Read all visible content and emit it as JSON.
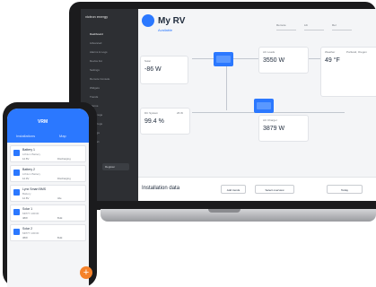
{
  "laptop": {
    "logo": "victron energy",
    "sidebar": [
      "Dashboard",
      "Advanced",
      "Alarms & Logs",
      "Device list",
      "Settings",
      "Remote Console",
      "Widgets",
      "Trends",
      "Alarms",
      "Alarm logs",
      "Event logs",
      "Settings",
      "Support"
    ],
    "active_index": 0,
    "footer": "Register",
    "title": "My RV",
    "status": "Available",
    "selects": [
      "Remote",
      "Lib",
      "Rel"
    ],
    "cards": {
      "solar": {
        "title": "Solar",
        "value": "-86 W"
      },
      "ac_loads": {
        "title": "AC Loads",
        "value": "3550 W"
      },
      "weather": {
        "title": "Weather",
        "value": "49 °F",
        "location": "Portland, Oregon"
      },
      "dc_system": {
        "title": "DC System",
        "value": "99.4 %",
        "extra": "26 W"
      },
      "ac_charger": {
        "title": "AC Charger",
        "value": "3879 W"
      }
    },
    "bottom": {
      "label": "Installation data",
      "btn1": "Add trends",
      "btn2": "Select overview",
      "btn3": "Today"
    }
  },
  "phone": {
    "title": "VRM",
    "tabs": [
      "Installations",
      "Map"
    ],
    "rows": [
      {
        "name": "Battery 1",
        "sub": "Lithium Battery",
        "m1": "12.8V",
        "m2": "Discharging"
      },
      {
        "name": "Battery 2",
        "sub": "Lithium Battery",
        "m1": "12.9V",
        "m2": "Discharging"
      },
      {
        "name": "Lynx Smart BMS",
        "sub": "Battery",
        "m1": "12.8V",
        "m2": "Idle"
      },
      {
        "name": "Solar 1",
        "sub": "MPPT 100/30",
        "m1": "48W",
        "m2": "Bulk"
      },
      {
        "name": "Solar 2",
        "sub": "MPPT 100/30",
        "m1": "38W",
        "m2": "Bulk"
      }
    ],
    "fab": "+"
  },
  "colors": {
    "accent": "#2b78ff",
    "fab": "#f5822a",
    "sidebar": "#2d2f33"
  }
}
